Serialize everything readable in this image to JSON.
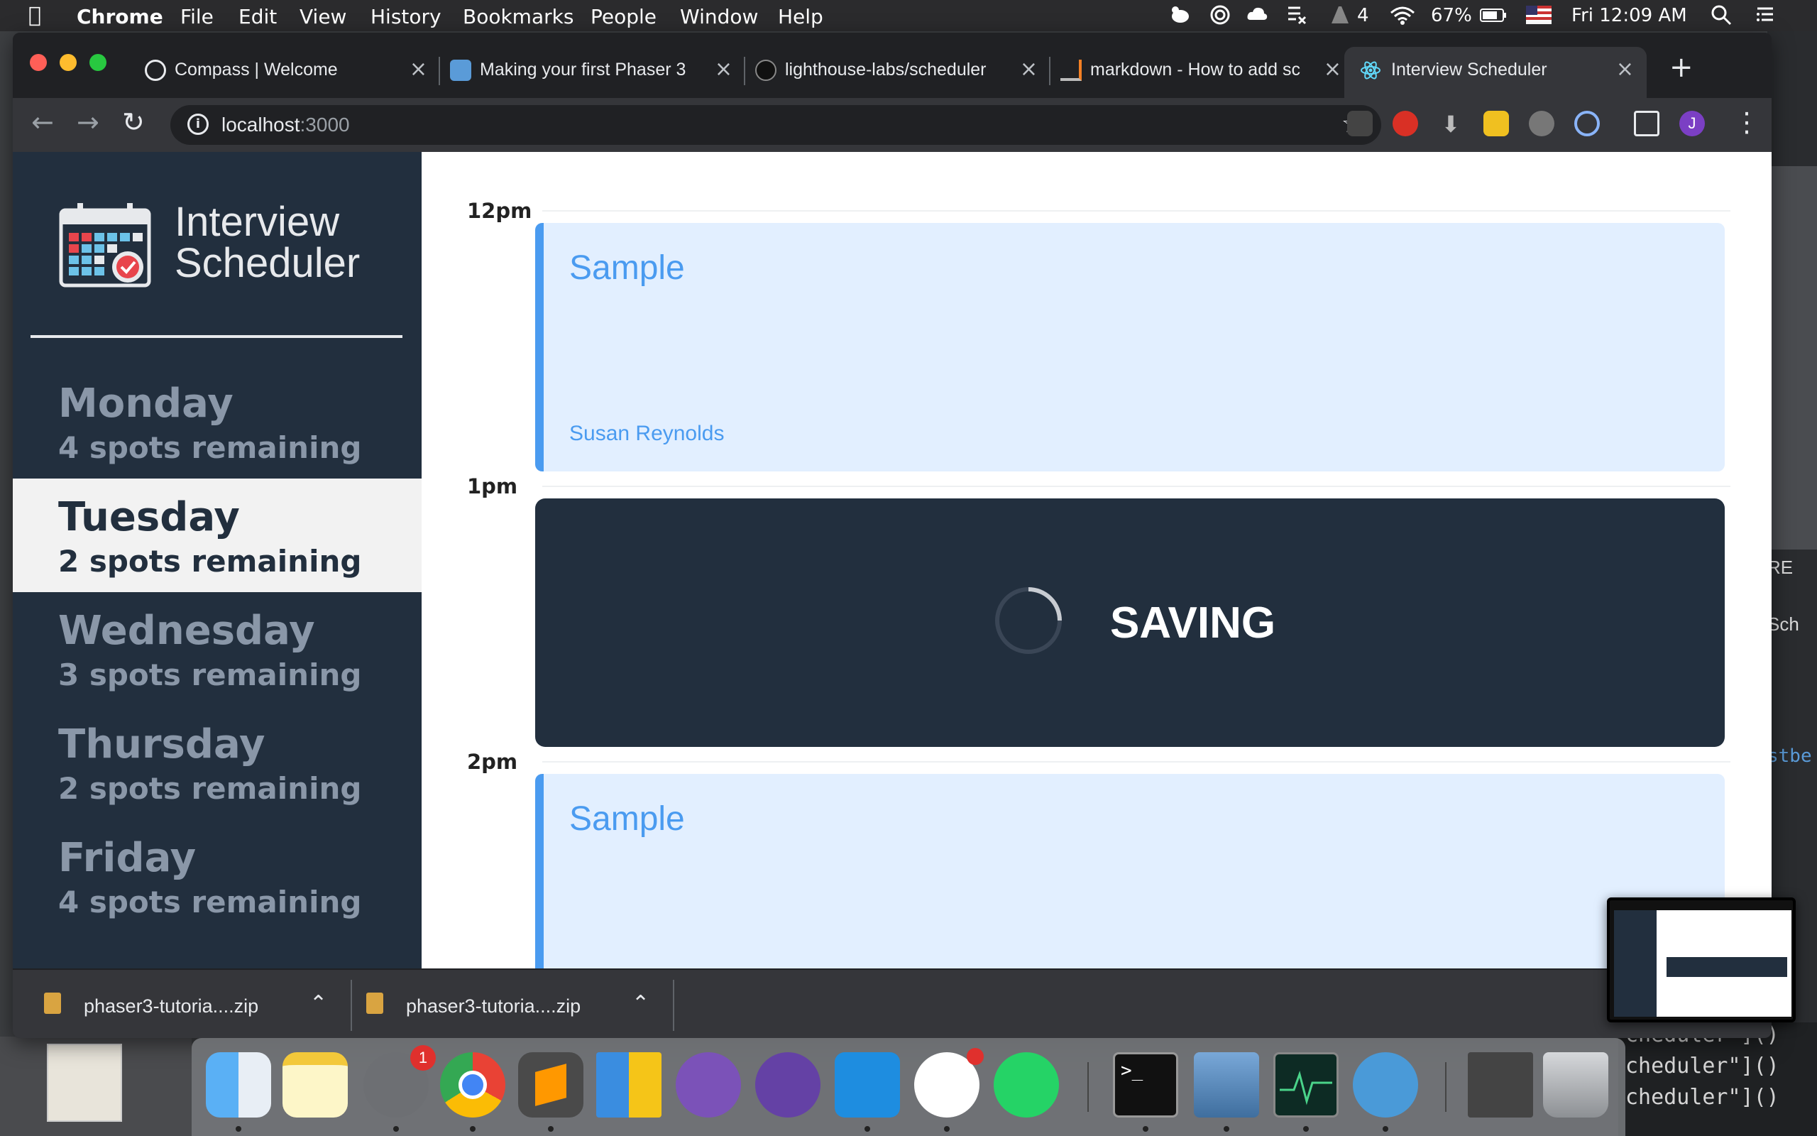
{
  "menubar": {
    "app": "Chrome",
    "items": [
      "File",
      "Edit",
      "View",
      "History",
      "Bookmarks",
      "People",
      "Window",
      "Help"
    ],
    "status_count": "4",
    "battery": "67%",
    "clock": "Fri 12:09 AM"
  },
  "browser": {
    "tabs": [
      {
        "title": "Compass | Welcome",
        "icon": "compass-icon"
      },
      {
        "title": "Making your first Phaser 3",
        "icon": "phaser-icon"
      },
      {
        "title": "lighthouse-labs/scheduler",
        "icon": "github-icon"
      },
      {
        "title": "markdown - How to add sc",
        "icon": "stackoverflow-icon"
      },
      {
        "title": "Interview Scheduler",
        "icon": "react-icon",
        "active": true
      }
    ],
    "address": {
      "host": "localhost",
      "port": ":3000"
    },
    "profile_initial": "J"
  },
  "app": {
    "logo_line1": "Interview",
    "logo_line2": "Scheduler",
    "days": [
      {
        "name": "Monday",
        "spots": "4 spots remaining"
      },
      {
        "name": "Tuesday",
        "spots": "2 spots remaining",
        "selected": true
      },
      {
        "name": "Wednesday",
        "spots": "3 spots remaining"
      },
      {
        "name": "Thursday",
        "spots": "2 spots remaining"
      },
      {
        "name": "Friday",
        "spots": "4 spots remaining"
      }
    ],
    "schedule": {
      "hours": [
        "12pm",
        "1pm",
        "2pm"
      ],
      "appointments": [
        {
          "student": "Sample",
          "interviewer": "Susan Reynolds"
        },
        {
          "status": "SAVING"
        },
        {
          "student": "Sample",
          "interviewer": ""
        }
      ]
    }
  },
  "downloads": [
    {
      "file": "phaser3-tutoria....zip"
    },
    {
      "file": "phaser3-tutoria....zip"
    }
  ],
  "background": {
    "code_lines": [
      "cheduler\"]()",
      "cheduler\"]()",
      "cheduler\"]()"
    ],
    "side_snippets": [
      "RE",
      "Sch",
      "stbe"
    ]
  },
  "dock": {
    "icons": [
      "finder-icon",
      "notes-icon",
      "system-preferences-icon",
      "chrome-icon",
      "sublime-text-icon",
      "windows-app-icon",
      "github-desktop-icon",
      "twitch-icon",
      "vscode-icon",
      "slack-icon",
      "whatsapp-icon",
      "terminal-icon",
      "preview-icon",
      "activity-monitor-icon",
      "tableplus-icon",
      "minimized-window-icon",
      "trash-icon"
    ],
    "badges": {
      "system_preferences": "1"
    }
  },
  "colors": {
    "sidebar": "#222f3e",
    "appointment_bg": "#e2efff",
    "appointment_accent": "#4a9bf0",
    "muted_day": "#8a97a8"
  }
}
